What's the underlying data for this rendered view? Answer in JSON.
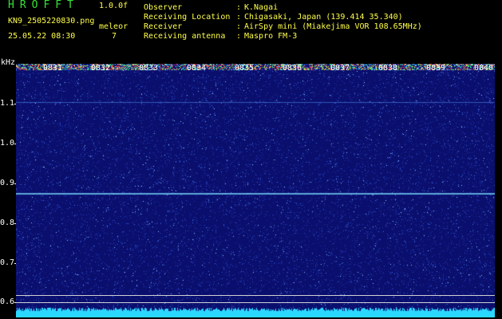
{
  "header": {
    "logo": "HROFFT",
    "version": "1.0.0f",
    "filename": "KN9_2505220830.png",
    "mode": "meleor",
    "datetime": "25.05.22 08:30",
    "count": "7"
  },
  "info": [
    {
      "label": "Observer",
      "value": "K.Nagai"
    },
    {
      "label": "Receiving Location",
      "value": "Chigasaki, Japan (139.414 35.340)"
    },
    {
      "label": "Receiver",
      "value": "AirSpy mini (Miakejima VOR 108.65MHz)"
    },
    {
      "label": "Receiving antenna",
      "value": "Maspro FM-3"
    }
  ],
  "spectrogram": {
    "unit": "kHz",
    "y_ticks": [
      "1.1",
      "1.0",
      "0.9",
      "0.8",
      "0.7",
      "0.6"
    ],
    "time_labels": [
      "0831",
      "0832",
      "0833",
      "0834",
      "0835",
      "0836",
      "0837",
      "0838",
      "0839",
      "0840"
    ],
    "background_color": "#0a0f6e",
    "signal_frequency_khz": 0.875
  }
}
